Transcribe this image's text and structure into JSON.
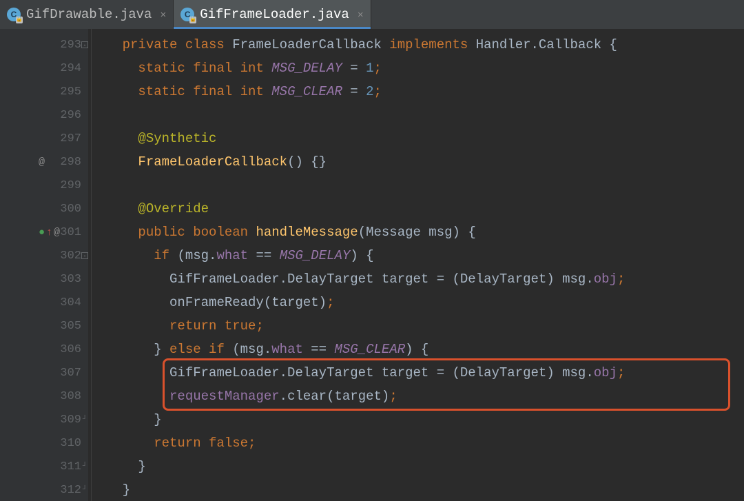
{
  "tabs": [
    {
      "label": "GifDrawable.java",
      "active": false
    },
    {
      "label": "GifFrameLoader.java",
      "active": true
    }
  ],
  "gutter": {
    "start": 293,
    "rows": [
      {
        "n": 293,
        "fold": "minus"
      },
      {
        "n": 294
      },
      {
        "n": 295
      },
      {
        "n": 296
      },
      {
        "n": 297
      },
      {
        "n": 298,
        "mark": "@"
      },
      {
        "n": 299
      },
      {
        "n": 300
      },
      {
        "n": 301,
        "mark": "override-@"
      },
      {
        "n": 302,
        "fold": "minus"
      },
      {
        "n": 303
      },
      {
        "n": 304
      },
      {
        "n": 305
      },
      {
        "n": 306
      },
      {
        "n": 307
      },
      {
        "n": 308
      },
      {
        "n": 309,
        "fold": "end"
      },
      {
        "n": 310
      },
      {
        "n": 311,
        "fold": "end"
      },
      {
        "n": 312,
        "fold": "end"
      }
    ]
  },
  "code": {
    "lines": [
      [
        {
          "t": "    ",
          "c": ""
        },
        {
          "t": "private class ",
          "c": "kw"
        },
        {
          "t": "FrameLoaderCallback ",
          "c": "type"
        },
        {
          "t": "implements ",
          "c": "kw"
        },
        {
          "t": "Handler.Callback {",
          "c": "type"
        }
      ],
      [
        {
          "t": "      ",
          "c": ""
        },
        {
          "t": "static final int ",
          "c": "kw"
        },
        {
          "t": "MSG_DELAY",
          "c": "const-it"
        },
        {
          "t": " = ",
          "c": "punc"
        },
        {
          "t": "1",
          "c": "num-lit"
        },
        {
          "t": ";",
          "c": "kw"
        }
      ],
      [
        {
          "t": "      ",
          "c": ""
        },
        {
          "t": "static final int ",
          "c": "kw"
        },
        {
          "t": "MSG_CLEAR",
          "c": "const-it"
        },
        {
          "t": " = ",
          "c": "punc"
        },
        {
          "t": "2",
          "c": "num-lit"
        },
        {
          "t": ";",
          "c": "kw"
        }
      ],
      [
        {
          "t": "",
          "c": ""
        }
      ],
      [
        {
          "t": "      ",
          "c": ""
        },
        {
          "t": "@Synthetic",
          "c": "anno"
        }
      ],
      [
        {
          "t": "      ",
          "c": ""
        },
        {
          "t": "FrameLoaderCallback",
          "c": "method"
        },
        {
          "t": "() {}",
          "c": "punc"
        }
      ],
      [
        {
          "t": "",
          "c": ""
        }
      ],
      [
        {
          "t": "      ",
          "c": ""
        },
        {
          "t": "@Override",
          "c": "anno"
        }
      ],
      [
        {
          "t": "      ",
          "c": ""
        },
        {
          "t": "public boolean ",
          "c": "kw"
        },
        {
          "t": "handleMessage",
          "c": "method"
        },
        {
          "t": "(Message msg) {",
          "c": "punc"
        }
      ],
      [
        {
          "t": "        ",
          "c": ""
        },
        {
          "t": "if ",
          "c": "kw"
        },
        {
          "t": "(msg.",
          "c": "punc"
        },
        {
          "t": "what ",
          "c": "field"
        },
        {
          "t": "== ",
          "c": "punc"
        },
        {
          "t": "MSG_DELAY",
          "c": "const-it"
        },
        {
          "t": ") {",
          "c": "punc"
        }
      ],
      [
        {
          "t": "          ",
          "c": ""
        },
        {
          "t": "GifFrameLoader.DelayTarget target = (DelayTarget) msg.",
          "c": "plain"
        },
        {
          "t": "obj",
          "c": "field"
        },
        {
          "t": ";",
          "c": "kw"
        }
      ],
      [
        {
          "t": "          ",
          "c": ""
        },
        {
          "t": "onFrameReady(target)",
          "c": "plain"
        },
        {
          "t": ";",
          "c": "kw"
        }
      ],
      [
        {
          "t": "          ",
          "c": ""
        },
        {
          "t": "return true",
          "c": "kw"
        },
        {
          "t": ";",
          "c": "kw"
        }
      ],
      [
        {
          "t": "        ",
          "c": ""
        },
        {
          "t": "} ",
          "c": "punc"
        },
        {
          "t": "else if ",
          "c": "kw"
        },
        {
          "t": "(msg.",
          "c": "punc"
        },
        {
          "t": "what ",
          "c": "field"
        },
        {
          "t": "== ",
          "c": "punc"
        },
        {
          "t": "MSG_CLEAR",
          "c": "const-it"
        },
        {
          "t": ") {",
          "c": "punc"
        }
      ],
      [
        {
          "t": "          ",
          "c": ""
        },
        {
          "t": "GifFrameLoader.DelayTarget target = (DelayTarget) msg.",
          "c": "plain"
        },
        {
          "t": "obj",
          "c": "field"
        },
        {
          "t": ";",
          "c": "kw"
        }
      ],
      [
        {
          "t": "          ",
          "c": ""
        },
        {
          "t": "requestManager",
          "c": "field"
        },
        {
          "t": ".clear(target)",
          "c": "plain"
        },
        {
          "t": ";",
          "c": "kw"
        }
      ],
      [
        {
          "t": "        ",
          "c": ""
        },
        {
          "t": "}",
          "c": "punc"
        }
      ],
      [
        {
          "t": "        ",
          "c": ""
        },
        {
          "t": "return false",
          "c": "kw"
        },
        {
          "t": ";",
          "c": "kw"
        }
      ],
      [
        {
          "t": "      ",
          "c": ""
        },
        {
          "t": "}",
          "c": "punc"
        }
      ],
      [
        {
          "t": "    ",
          "c": ""
        },
        {
          "t": "}",
          "c": "punc"
        }
      ]
    ]
  },
  "highlight": {
    "top_line_index": 14,
    "height_lines": 2
  }
}
